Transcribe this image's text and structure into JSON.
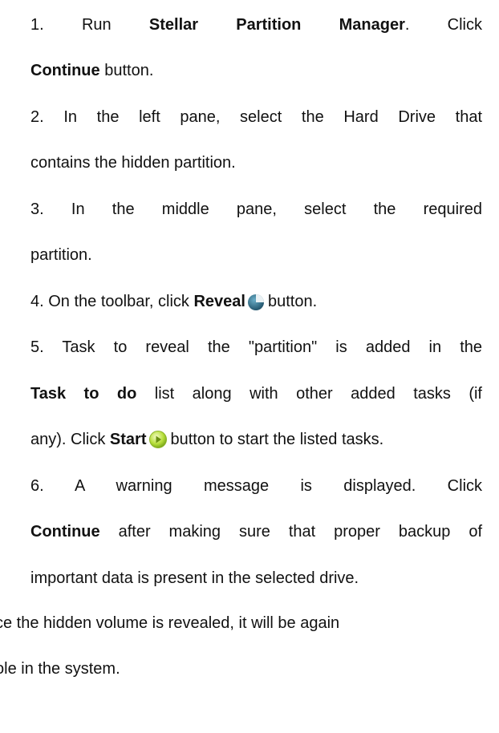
{
  "steps": [
    {
      "number": "1.",
      "line1": {
        "pre": "Run",
        "app": "Stellar Partition Manager",
        "post": ". Click"
      },
      "line2": {
        "bold": "Continue",
        "post": " button."
      }
    },
    {
      "number": "2.",
      "line1": "In the left pane, select the Hard Drive that",
      "line2": "contains the hidden partition."
    },
    {
      "number": "3.",
      "line1": "In the middle pane, select the required",
      "line2": "partition."
    },
    {
      "number": "4.",
      "pre": "On the toolbar, click",
      "bold": "Reveal",
      "icon": "reveal-pie-icon",
      "post": "button."
    },
    {
      "number": "5.",
      "line1": "Task to reveal the \"partition\" is added in the",
      "line2": {
        "bold": "Task to do",
        "post": " list along with other added tasks (if"
      },
      "line3": {
        "pre": "any). Click",
        "bold": "Start",
        "icon": "start-play-icon",
        "post": "button to start the listed tasks."
      }
    },
    {
      "number": "6.",
      "line1": "A warning message is displayed. Click",
      "line2": {
        "bold": "Continue",
        "post": " after making sure that proper backup of"
      },
      "line3": "important data is present in the selected drive."
    }
  ],
  "footer": {
    "line1": "ce the hidden volume is revealed, it will be again",
    "line2": "ole in the system."
  },
  "colors": {
    "text": "#111111",
    "background": "#ffffff",
    "reveal_icon": "#2f6b84",
    "start_icon": "#9bcf2a"
  }
}
